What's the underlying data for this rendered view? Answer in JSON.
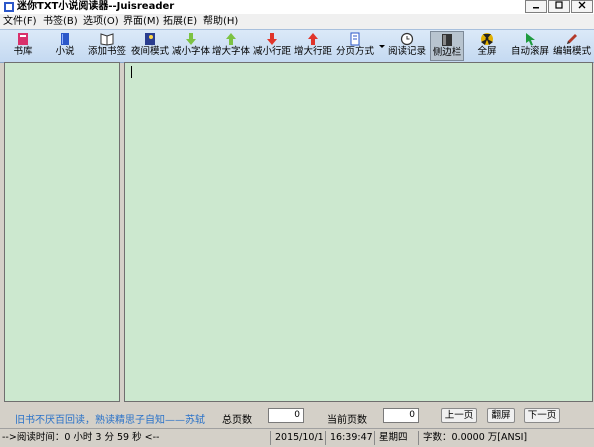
{
  "window": {
    "title": "迷你TXT小说阅读器--Juisreader",
    "controls": [
      "0",
      "1",
      "r"
    ]
  },
  "menu": [
    {
      "label": "文件(F)"
    },
    {
      "label": "书签(B)"
    },
    {
      "label": "选项(O)"
    },
    {
      "label": "界面(M)"
    },
    {
      "label": "拓展(E)"
    },
    {
      "label": "帮助(H)"
    }
  ],
  "toolbar": [
    {
      "label": "书库",
      "icon": "bookshelf-icon",
      "color": "#d9306b"
    },
    {
      "label": "小说",
      "icon": "book-icon",
      "color": "#2b57c9"
    },
    {
      "label": "添加书签",
      "icon": "open-book-icon",
      "color": "#333333"
    },
    {
      "label": "夜间模式",
      "icon": "night-icon",
      "color": "#2a3d8f"
    },
    {
      "label": "减小字体",
      "icon": "arrow-down-icon",
      "color": "#7cc243"
    },
    {
      "label": "增大字体",
      "icon": "arrow-up-icon",
      "color": "#7cc243"
    },
    {
      "label": "减小行距",
      "icon": "arrow-down-icon",
      "color": "#e0352b"
    },
    {
      "label": "增大行距",
      "icon": "arrow-up-icon",
      "color": "#e0352b"
    },
    {
      "label": "分页方式",
      "icon": "page-icon",
      "color": "#2b57c9"
    },
    {
      "label": "阅读记录",
      "icon": "clock-icon",
      "color": "#333333"
    },
    {
      "label": "侧边栏",
      "icon": "sidebar-icon",
      "color": "#333333"
    },
    {
      "label": "全屏",
      "icon": "fullscreen-icon",
      "color": "#e2b000"
    },
    {
      "label": "自动滚屏",
      "icon": "cursor-icon",
      "color": "#1f9b3f"
    },
    {
      "label": "编辑模式",
      "icon": "pencil-icon",
      "color": "#b33a2a"
    }
  ],
  "bottom": {
    "quote": "旧书不厌百回读，熟读精思子自知——苏轼",
    "total_pages_label": "总页数",
    "total_pages_value": "0",
    "current_page_label": "当前页数",
    "current_page_value": "0",
    "prev_label": "上一页",
    "flip_label": "翻屏",
    "next_label": "下一页"
  },
  "status": {
    "reading_time": "-->阅读时间：0 小时 3 分 59 秒 <--",
    "date": "2015/10/1",
    "time": "16:39:47",
    "weekday": "星期四",
    "word_count": "字数：0.0000 万[ANSI]"
  },
  "colors": {
    "reading_bg": "#cce8cf",
    "quote_color": "#2a72c9"
  }
}
